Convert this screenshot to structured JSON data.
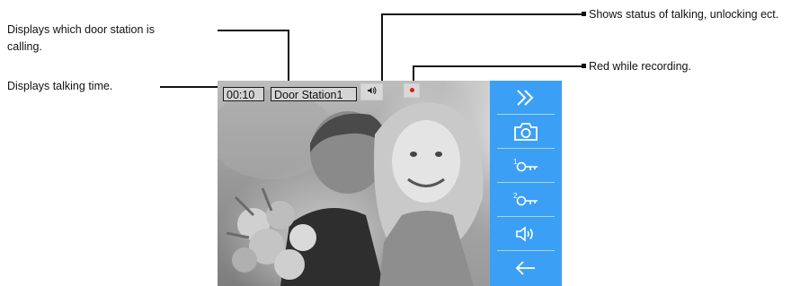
{
  "annotations": {
    "door_station": "Displays which door station is calling.",
    "talking_time": "Displays talking time.",
    "status": "Shows status of talking, unlocking ect.",
    "recording": "Red while recording."
  },
  "overlay": {
    "talk_time": "00:10",
    "door_station_name": "Door Station1"
  },
  "sidebar": {
    "buttons": [
      {
        "icon": "double-chevron-right-icon"
      },
      {
        "icon": "camera-icon"
      },
      {
        "icon": "unlock-1-icon",
        "label": "1"
      },
      {
        "icon": "unlock-2-icon",
        "label": "2"
      },
      {
        "icon": "speaker-volume-icon"
      },
      {
        "icon": "back-arrow-icon"
      }
    ]
  },
  "colors": {
    "sidebar": "#3b9ff6",
    "recording": "#e11a1a"
  }
}
